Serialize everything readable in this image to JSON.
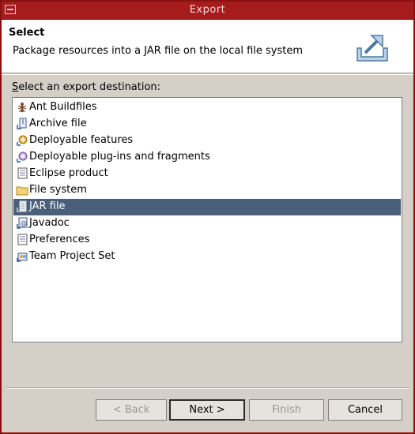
{
  "window": {
    "title": "Export"
  },
  "header": {
    "title": "Select",
    "description": "Package resources into a JAR file on the local file system",
    "icon": "export-icon"
  },
  "list_label": {
    "prefix": "S",
    "rest": "elect an export destination:"
  },
  "items": [
    {
      "label": "Ant Buildfiles",
      "icon": "ant-icon",
      "selected": false
    },
    {
      "label": "Archive file",
      "icon": "archive-file-icon",
      "selected": false
    },
    {
      "label": "Deployable features",
      "icon": "deployable-features-icon",
      "selected": false
    },
    {
      "label": "Deployable plug-ins and fragments",
      "icon": "plugin-icon",
      "selected": false
    },
    {
      "label": "Eclipse product",
      "icon": "eclipse-product-icon",
      "selected": false
    },
    {
      "label": "File system",
      "icon": "folder-icon",
      "selected": false
    },
    {
      "label": "JAR file",
      "icon": "jar-icon",
      "selected": true
    },
    {
      "label": "Javadoc",
      "icon": "javadoc-icon",
      "selected": false
    },
    {
      "label": "Preferences",
      "icon": "preferences-icon",
      "selected": false
    },
    {
      "label": "Team Project Set",
      "icon": "team-project-icon",
      "selected": false
    }
  ],
  "buttons": {
    "back": "< Back",
    "next": "Next >",
    "finish": "Finish",
    "cancel": "Cancel"
  },
  "colors": {
    "titlebar": "#a61b1b",
    "selection": "#4a5f79",
    "dialog": "#d4d0c8"
  }
}
